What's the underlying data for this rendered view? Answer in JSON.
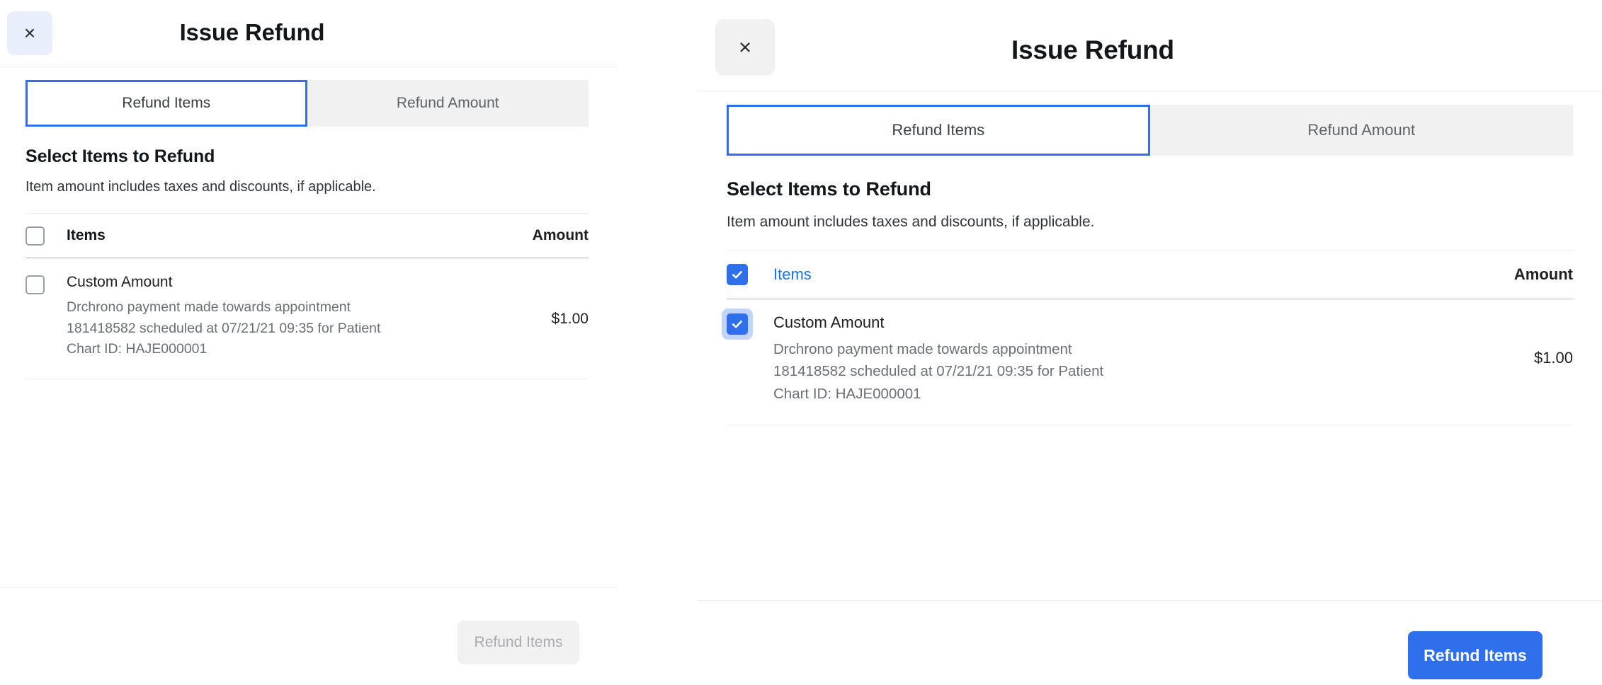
{
  "panels": [
    {
      "id": "left",
      "close_icon": "close-icon",
      "close_glyph": "×",
      "title": "Issue Refund",
      "tabs": [
        {
          "label": "Refund Items",
          "active": true
        },
        {
          "label": "Refund Amount",
          "active": false
        }
      ],
      "section": {
        "title": "Select Items to Refund",
        "subtitle": "Item amount includes taxes and discounts, if applicable."
      },
      "table": {
        "headers": {
          "items": "Items",
          "amount": "Amount"
        },
        "select_all_checked": false,
        "rows": [
          {
            "name": "Custom Amount",
            "description": "Drchrono payment made towards appointment 181418582 scheduled at 07/21/21 09:35 for Patient Chart ID: HAJE000001",
            "desc_lines": [
              "Drchrono payment made towards appointment",
              "181418582 scheduled at 07/21/21 09:35 for Patient",
              "Chart ID: HAJE000001"
            ],
            "amount": "$1.00",
            "checked": false
          }
        ]
      },
      "footer": {
        "button_label": "Refund Items",
        "button_enabled": false
      },
      "colors": {
        "accent": "#2f6fec",
        "close_bg": "#e8eefb",
        "tab_inactive_bg": "#f1f1f1",
        "button_bg": "#f1f1f2",
        "button_text": "#a9abae"
      }
    },
    {
      "id": "right",
      "close_icon": "close-icon",
      "close_glyph": "×",
      "title": "Issue Refund",
      "tabs": [
        {
          "label": "Refund Items",
          "active": true
        },
        {
          "label": "Refund Amount",
          "active": false
        }
      ],
      "section": {
        "title": "Select Items to Refund",
        "subtitle": "Item amount includes taxes and discounts, if applicable."
      },
      "table": {
        "headers": {
          "items": "Items",
          "amount": "Amount"
        },
        "select_all_checked": true,
        "rows": [
          {
            "name": "Custom Amount",
            "description": "Drchrono payment made towards appointment 181418582 scheduled at 07/21/21 09:35 for Patient Chart ID: HAJE000001",
            "desc_lines": [
              "Drchrono payment made towards appointment",
              "181418582 scheduled at 07/21/21 09:35 for Patient",
              "Chart ID: HAJE000001"
            ],
            "amount": "$1.00",
            "checked": true
          }
        ]
      },
      "footer": {
        "button_label": "Refund Items",
        "button_enabled": true
      },
      "colors": {
        "accent": "#2f6fec",
        "close_bg": "#f1f1f1",
        "tab_inactive_bg": "#f1f1f1",
        "button_bg": "#2f6fec",
        "button_text": "#ffffff",
        "focus_ring": "#c2d4fb"
      }
    }
  ]
}
